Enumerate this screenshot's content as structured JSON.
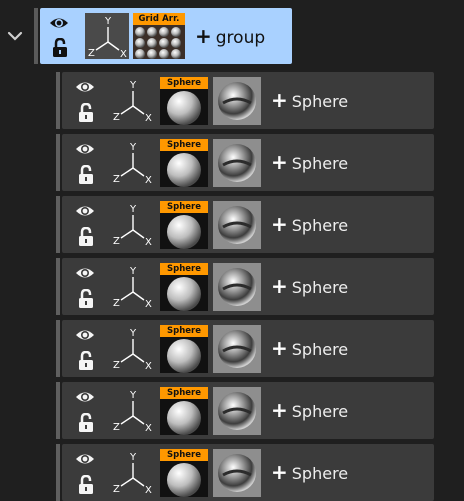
{
  "group": {
    "label": "group",
    "badge": "Grid Arr.",
    "expanded": true,
    "axes": {
      "y": "Y",
      "z": "Z",
      "x": "X"
    }
  },
  "children": [
    {
      "label": "Sphere",
      "badge": "Sphere",
      "axes": {
        "y": "Y",
        "z": "Z",
        "x": "X"
      }
    },
    {
      "label": "Sphere",
      "badge": "Sphere",
      "axes": {
        "y": "Y",
        "z": "Z",
        "x": "X"
      }
    },
    {
      "label": "Sphere",
      "badge": "Sphere",
      "axes": {
        "y": "Y",
        "z": "Z",
        "x": "X"
      }
    },
    {
      "label": "Sphere",
      "badge": "Sphere",
      "axes": {
        "y": "Y",
        "z": "Z",
        "x": "X"
      }
    },
    {
      "label": "Sphere",
      "badge": "Sphere",
      "axes": {
        "y": "Y",
        "z": "Z",
        "x": "X"
      }
    },
    {
      "label": "Sphere",
      "badge": "Sphere",
      "axes": {
        "y": "Y",
        "z": "Z",
        "x": "X"
      }
    },
    {
      "label": "Sphere",
      "badge": "Sphere",
      "axes": {
        "y": "Y",
        "z": "Z",
        "x": "X"
      }
    }
  ],
  "icons": {
    "expand": "chevron-down-icon",
    "visibility": "eye-icon",
    "lock": "lock-icon",
    "transform": "axes-icon",
    "add": "plus-icon"
  },
  "colors": {
    "selected_row": "#a9d1ff",
    "row_bg": "#3b3b3b",
    "badge": "#ff9800"
  }
}
